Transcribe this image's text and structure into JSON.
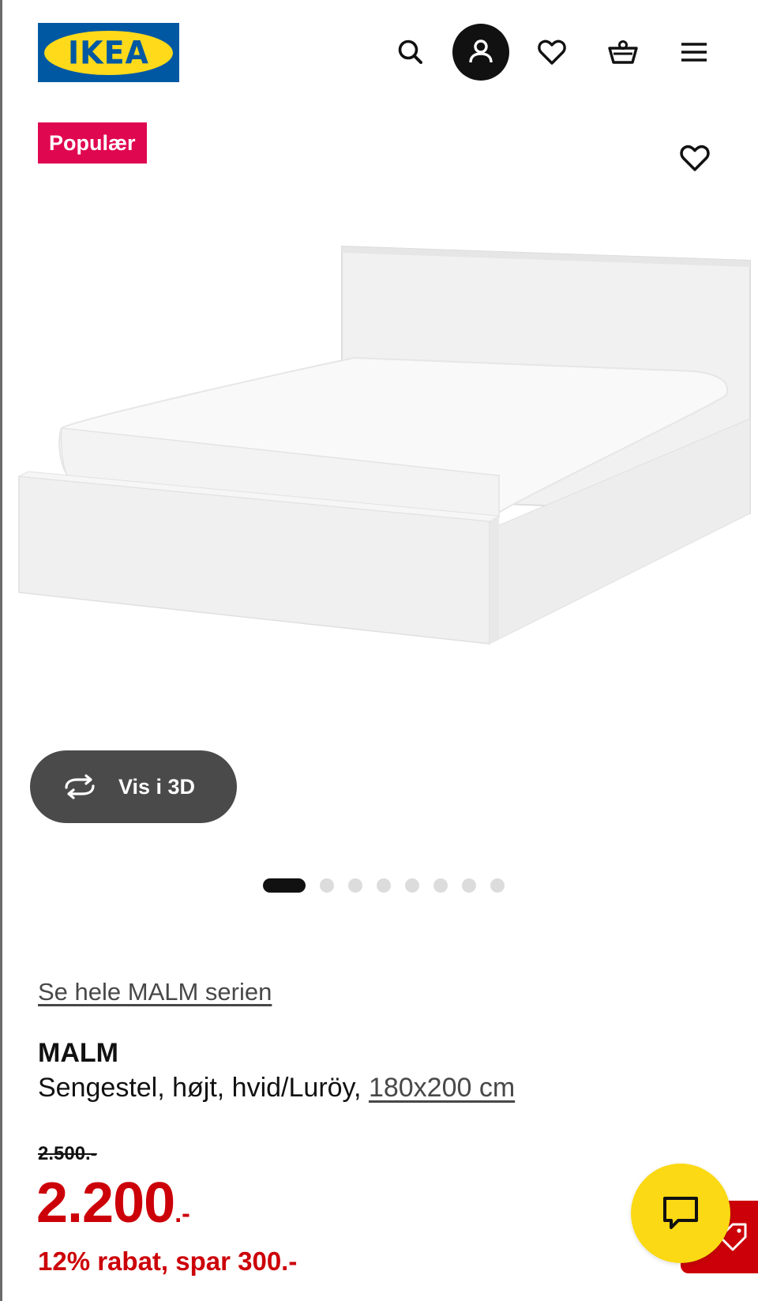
{
  "header": {
    "logo_text": "IKEA",
    "icons": [
      "search-icon",
      "user-icon",
      "heart-icon",
      "shopping-bag-icon",
      "menu-icon"
    ]
  },
  "product": {
    "badge": "Populær",
    "view_3d_label": "Vis i 3D",
    "carousel": {
      "total": 8,
      "active_index": 0
    },
    "series_link": "Se hele MALM serien",
    "name": "MALM",
    "description": "Sengestel, højt, hvid/Luröy, ",
    "size": "180x200 cm",
    "old_price": "2.500.-",
    "price_main": "2.200",
    "price_suffix": ".-",
    "discount_text": "12% rabat, spar 300.-"
  },
  "colors": {
    "ikea_blue": "#0058a3",
    "ikea_yellow": "#ffda1a",
    "badge_pink": "#e00751",
    "price_red": "#cc0008",
    "chat_yellow": "#fbd914"
  }
}
